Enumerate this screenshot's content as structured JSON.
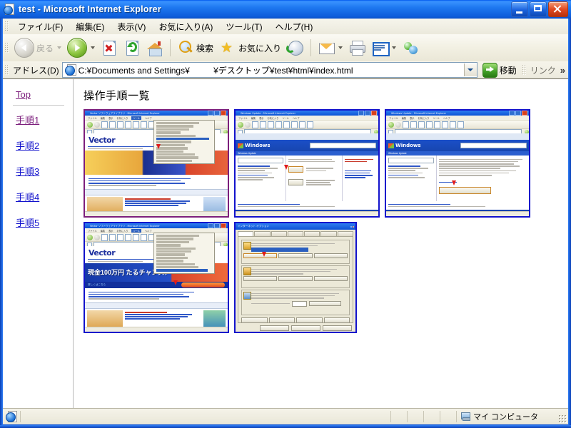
{
  "window": {
    "title": "test - Microsoft Internet Explorer",
    "icon": "ie-page-icon",
    "controls": {
      "minimize": "minimize",
      "maximize": "maximize",
      "close": "close"
    }
  },
  "menubar": {
    "items": [
      {
        "label": "ファイル(F)",
        "name": "menu-file"
      },
      {
        "label": "編集(E)",
        "name": "menu-edit"
      },
      {
        "label": "表示(V)",
        "name": "menu-view"
      },
      {
        "label": "お気に入り(A)",
        "name": "menu-favorites"
      },
      {
        "label": "ツール(T)",
        "name": "menu-tools"
      },
      {
        "label": "ヘルプ(H)",
        "name": "menu-help"
      }
    ]
  },
  "toolbar": {
    "back_label": "戻る",
    "back_enabled": false,
    "forward_label": "",
    "search_label": "検索",
    "favorites_label": "お気に入り",
    "icons": {
      "back": "back-arrow-icon",
      "forward": "forward-arrow-icon",
      "stop": "stop-icon",
      "refresh": "refresh-icon",
      "home": "home-icon",
      "search": "magnifier-icon",
      "favorites": "star-icon",
      "history": "history-icon",
      "mail": "mail-icon",
      "print": "printer-icon",
      "edit": "edit-page-icon",
      "messenger": "messenger-icon"
    }
  },
  "addressbar": {
    "label": "アドレス(D)",
    "value": "C:¥Documents and Settings¥          ¥デスクトップ¥test¥html¥index.html",
    "go_label": "移動",
    "links_label": "リンク",
    "overflow_chevron": "»"
  },
  "sidebar": {
    "items": [
      {
        "label": "Top",
        "state": "visited",
        "name": "sidebar-link-top"
      },
      {
        "label": "手順1",
        "state": "visited",
        "name": "sidebar-link-step1"
      },
      {
        "label": "手順2",
        "state": "unvisited",
        "name": "sidebar-link-step2"
      },
      {
        "label": "手順3",
        "state": "unvisited",
        "name": "sidebar-link-step3"
      },
      {
        "label": "手順4",
        "state": "unvisited",
        "name": "sidebar-link-step4"
      },
      {
        "label": "手順5",
        "state": "unvisited",
        "name": "sidebar-link-step5"
      }
    ]
  },
  "content": {
    "heading": "操作手順一覧",
    "thumbnails": [
      {
        "name": "thumbnail-step1",
        "kind": "vector-site-menu",
        "border_state": "visited",
        "mini_title": "Vector ソフトウェアライブラリ - Microsoft Internet Explorer",
        "mini_logo": "Vector",
        "banner_text": ""
      },
      {
        "name": "thumbnail-step2",
        "kind": "windows-update",
        "border_state": "unvisited",
        "mini_title": "Windows Update - Microsoft Internet Explorer",
        "mini_logo": "Windows",
        "subtitle": "Windows Update"
      },
      {
        "name": "thumbnail-step3",
        "kind": "windows-update-list",
        "border_state": "unvisited",
        "mini_title": "Windows Update - Microsoft Internet Explorer",
        "mini_logo": "Windows",
        "subtitle": "Windows Update"
      },
      {
        "name": "thumbnail-step4",
        "kind": "vector-site-banner",
        "border_state": "unvisited",
        "mini_title": "Vector ソフトウェアライブラリ - Microsoft Internet Explorer",
        "mini_logo": "Vector",
        "banner_text": "現金100万円          たるチャンス！"
      },
      {
        "name": "thumbnail-step5",
        "kind": "internet-options-dialog",
        "border_state": "unvisited",
        "dialog_title": "インターネット オプション"
      }
    ]
  },
  "statusbar": {
    "message": "",
    "zone": "マイ コンピュータ",
    "zone_icon": "my-computer-icon"
  },
  "colors": {
    "title_blue": "#0a50c8",
    "link_unvisited": "#1212cc",
    "link_visited": "#7c1e7c",
    "chrome": "#ece9d8"
  }
}
